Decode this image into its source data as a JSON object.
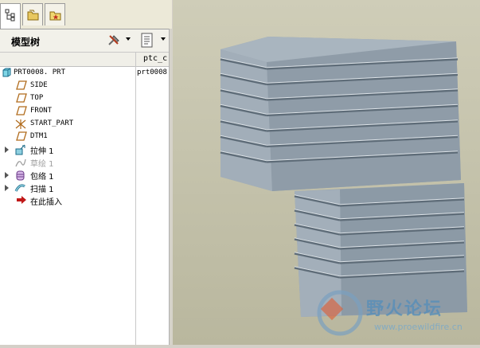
{
  "panel": {
    "title": "模型树",
    "column_header": "ptc_c",
    "column_value": "prt0008"
  },
  "tabs": [
    {
      "icon": "model-tree-icon",
      "active": true
    },
    {
      "icon": "folder-browser-icon",
      "active": false
    },
    {
      "icon": "favorites-icon",
      "active": false
    }
  ],
  "tree": {
    "root": "PRT0008. PRT",
    "items": [
      {
        "label": "SIDE",
        "icon": "datum-plane-icon"
      },
      {
        "label": "TOP",
        "icon": "datum-plane-icon"
      },
      {
        "label": "FRONT",
        "icon": "datum-plane-icon"
      },
      {
        "label": "START_PART",
        "icon": "csys-icon"
      },
      {
        "label": "DTM1",
        "icon": "datum-plane-icon"
      },
      {
        "label": "拉伸 1",
        "icon": "extrude-icon"
      },
      {
        "label": "草绘 1",
        "icon": "sketch-icon"
      },
      {
        "label": "包络 1",
        "icon": "wrap-icon"
      },
      {
        "label": "扫描 1",
        "icon": "sweep-icon"
      },
      {
        "label": "在此插入",
        "icon": "insert-here-arrow-icon"
      }
    ]
  },
  "watermark": {
    "text": "野火论坛",
    "url": "www.proewildfire.cn"
  },
  "colors": {
    "viewport_bg": "#c4c2aa",
    "part_face": "#9aa7b3",
    "part_top": "#a9b5bf",
    "datum_plane": "#b06a1a"
  }
}
